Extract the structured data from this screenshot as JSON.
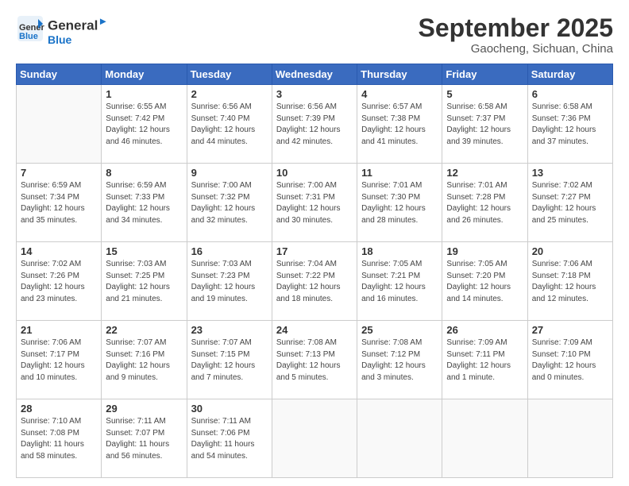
{
  "header": {
    "logo_line1": "General",
    "logo_line2": "Blue",
    "month": "September 2025",
    "location": "Gaocheng, Sichuan, China"
  },
  "weekdays": [
    "Sunday",
    "Monday",
    "Tuesday",
    "Wednesday",
    "Thursday",
    "Friday",
    "Saturday"
  ],
  "weeks": [
    [
      {
        "day": "",
        "info": ""
      },
      {
        "day": "1",
        "info": "Sunrise: 6:55 AM\nSunset: 7:42 PM\nDaylight: 12 hours\nand 46 minutes."
      },
      {
        "day": "2",
        "info": "Sunrise: 6:56 AM\nSunset: 7:40 PM\nDaylight: 12 hours\nand 44 minutes."
      },
      {
        "day": "3",
        "info": "Sunrise: 6:56 AM\nSunset: 7:39 PM\nDaylight: 12 hours\nand 42 minutes."
      },
      {
        "day": "4",
        "info": "Sunrise: 6:57 AM\nSunset: 7:38 PM\nDaylight: 12 hours\nand 41 minutes."
      },
      {
        "day": "5",
        "info": "Sunrise: 6:58 AM\nSunset: 7:37 PM\nDaylight: 12 hours\nand 39 minutes."
      },
      {
        "day": "6",
        "info": "Sunrise: 6:58 AM\nSunset: 7:36 PM\nDaylight: 12 hours\nand 37 minutes."
      }
    ],
    [
      {
        "day": "7",
        "info": "Sunrise: 6:59 AM\nSunset: 7:34 PM\nDaylight: 12 hours\nand 35 minutes."
      },
      {
        "day": "8",
        "info": "Sunrise: 6:59 AM\nSunset: 7:33 PM\nDaylight: 12 hours\nand 34 minutes."
      },
      {
        "day": "9",
        "info": "Sunrise: 7:00 AM\nSunset: 7:32 PM\nDaylight: 12 hours\nand 32 minutes."
      },
      {
        "day": "10",
        "info": "Sunrise: 7:00 AM\nSunset: 7:31 PM\nDaylight: 12 hours\nand 30 minutes."
      },
      {
        "day": "11",
        "info": "Sunrise: 7:01 AM\nSunset: 7:30 PM\nDaylight: 12 hours\nand 28 minutes."
      },
      {
        "day": "12",
        "info": "Sunrise: 7:01 AM\nSunset: 7:28 PM\nDaylight: 12 hours\nand 26 minutes."
      },
      {
        "day": "13",
        "info": "Sunrise: 7:02 AM\nSunset: 7:27 PM\nDaylight: 12 hours\nand 25 minutes."
      }
    ],
    [
      {
        "day": "14",
        "info": "Sunrise: 7:02 AM\nSunset: 7:26 PM\nDaylight: 12 hours\nand 23 minutes."
      },
      {
        "day": "15",
        "info": "Sunrise: 7:03 AM\nSunset: 7:25 PM\nDaylight: 12 hours\nand 21 minutes."
      },
      {
        "day": "16",
        "info": "Sunrise: 7:03 AM\nSunset: 7:23 PM\nDaylight: 12 hours\nand 19 minutes."
      },
      {
        "day": "17",
        "info": "Sunrise: 7:04 AM\nSunset: 7:22 PM\nDaylight: 12 hours\nand 18 minutes."
      },
      {
        "day": "18",
        "info": "Sunrise: 7:05 AM\nSunset: 7:21 PM\nDaylight: 12 hours\nand 16 minutes."
      },
      {
        "day": "19",
        "info": "Sunrise: 7:05 AM\nSunset: 7:20 PM\nDaylight: 12 hours\nand 14 minutes."
      },
      {
        "day": "20",
        "info": "Sunrise: 7:06 AM\nSunset: 7:18 PM\nDaylight: 12 hours\nand 12 minutes."
      }
    ],
    [
      {
        "day": "21",
        "info": "Sunrise: 7:06 AM\nSunset: 7:17 PM\nDaylight: 12 hours\nand 10 minutes."
      },
      {
        "day": "22",
        "info": "Sunrise: 7:07 AM\nSunset: 7:16 PM\nDaylight: 12 hours\nand 9 minutes."
      },
      {
        "day": "23",
        "info": "Sunrise: 7:07 AM\nSunset: 7:15 PM\nDaylight: 12 hours\nand 7 minutes."
      },
      {
        "day": "24",
        "info": "Sunrise: 7:08 AM\nSunset: 7:13 PM\nDaylight: 12 hours\nand 5 minutes."
      },
      {
        "day": "25",
        "info": "Sunrise: 7:08 AM\nSunset: 7:12 PM\nDaylight: 12 hours\nand 3 minutes."
      },
      {
        "day": "26",
        "info": "Sunrise: 7:09 AM\nSunset: 7:11 PM\nDaylight: 12 hours\nand 1 minute."
      },
      {
        "day": "27",
        "info": "Sunrise: 7:09 AM\nSunset: 7:10 PM\nDaylight: 12 hours\nand 0 minutes."
      }
    ],
    [
      {
        "day": "28",
        "info": "Sunrise: 7:10 AM\nSunset: 7:08 PM\nDaylight: 11 hours\nand 58 minutes."
      },
      {
        "day": "29",
        "info": "Sunrise: 7:11 AM\nSunset: 7:07 PM\nDaylight: 11 hours\nand 56 minutes."
      },
      {
        "day": "30",
        "info": "Sunrise: 7:11 AM\nSunset: 7:06 PM\nDaylight: 11 hours\nand 54 minutes."
      },
      {
        "day": "",
        "info": ""
      },
      {
        "day": "",
        "info": ""
      },
      {
        "day": "",
        "info": ""
      },
      {
        "day": "",
        "info": ""
      }
    ]
  ]
}
